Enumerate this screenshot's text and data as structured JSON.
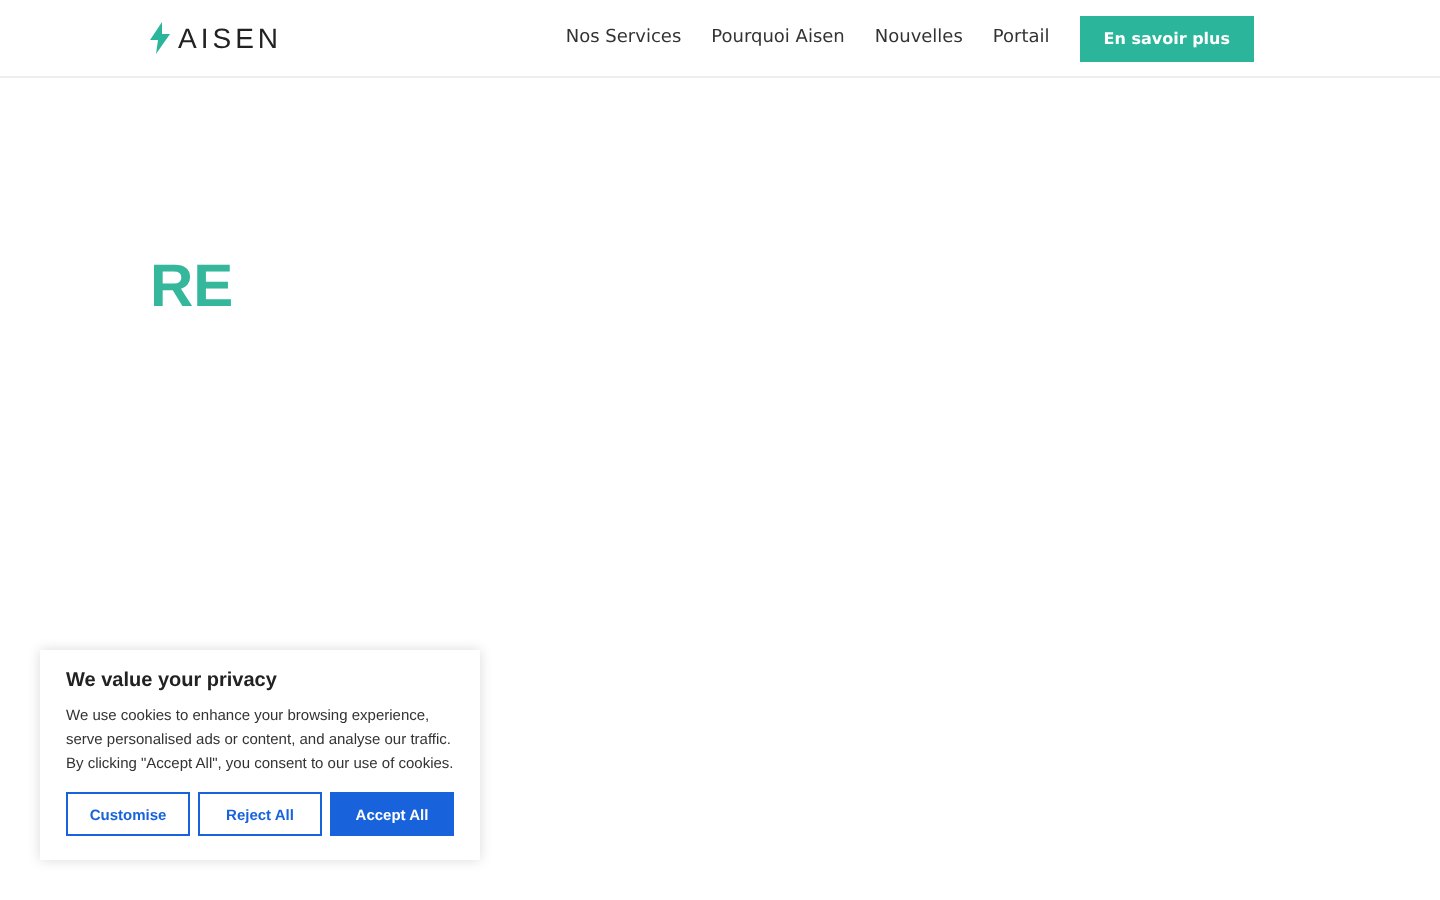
{
  "header": {
    "logo": "AISEN",
    "nav": [
      "Nos Services",
      "Pourquoi Aisen",
      "Nouvelles",
      "Portail"
    ],
    "cta": "En savoir plus"
  },
  "hero": {
    "heading": "RE"
  },
  "cookie_banner": {
    "title": "We value your privacy",
    "text": "We use cookies to enhance your browsing experience, serve personalised ads or content, and analyse our traffic. By clicking \"Accept All\", you consent to our use of cookies.",
    "buttons": [
      {
        "label": "Customise",
        "kind": "outline"
      },
      {
        "label": "Reject All",
        "kind": "outline"
      },
      {
        "label": "Accept All",
        "kind": "primary"
      }
    ]
  }
}
